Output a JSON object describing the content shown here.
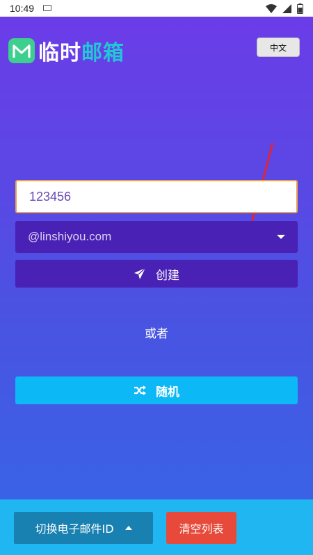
{
  "status_bar": {
    "time": "10:49",
    "icons": [
      "notification-icon",
      "wifi-icon",
      "signal-icon",
      "battery-icon"
    ]
  },
  "header": {
    "logo_text_white": "临时",
    "logo_text_accent": "邮箱",
    "language_button": "中文"
  },
  "form": {
    "username_value": "123456",
    "domain_selected": "@linshiyou.com",
    "create_label": "创建",
    "or_label": "或者",
    "random_label": "随机"
  },
  "bottom_bar": {
    "switch_label": "切换电子邮件ID",
    "clear_label": "清空列表"
  },
  "colors": {
    "primary_dark": "#4a21b5",
    "accent_cyan": "#0cb8f5",
    "danger": "#e74a3a",
    "logo_green": "#3ccf8e"
  }
}
